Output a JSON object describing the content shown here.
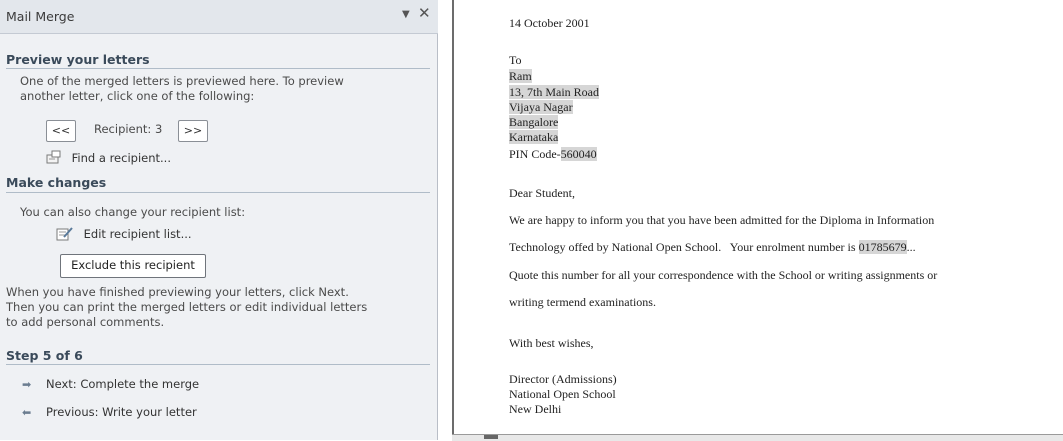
{
  "pane": {
    "title": "Mail Merge",
    "dropdown_glyph": "▼",
    "close_glyph": "✕",
    "preview": {
      "heading": "Preview your letters",
      "desc_line1": "One of the merged letters is previewed here. To preview",
      "desc_line2": "another letter, click one of the following:",
      "prev_label": "<<",
      "next_label": ">>",
      "recipient_label": "Recipient: 3",
      "find_label": "Find a recipient..."
    },
    "changes": {
      "heading": "Make changes",
      "desc": "You can also change your recipient list:",
      "edit_label": "Edit recipient list...",
      "exclude_label": "Exclude this recipient",
      "finish_line1": "When you have finished previewing your letters, click Next.",
      "finish_line2": "Then you can print the merged letters or edit individual letters",
      "finish_line3": "to add personal comments."
    },
    "step": {
      "heading": "Step 5 of 6",
      "next_label": "Next: Complete the merge",
      "prev_label": "Previous: Write your letter"
    }
  },
  "document": {
    "date": "14 October 2001",
    "to": "To",
    "name": "Ram",
    "address1": "13, 7th Main Road",
    "address2": "Vijaya Nagar",
    "city": "Bangalore",
    "state": "Karnataka",
    "pin_label": "PIN Code-",
    "pin_value": "560040",
    "salutation": "Dear Student,",
    "body_line1": "We are happy to inform you that you have been admitted for the Diploma in Information",
    "body_line2a": "Technology offed by National Open School.   Your enrolment number is ",
    "enrolment": "01785679",
    "body_line2b": "...",
    "body_line3": "Quote this number for all your correspondence with the School or writing assignments or",
    "body_line4": "writing termend examinations.",
    "closing": "With best wishes,",
    "sign1": "Director (Admissions)",
    "sign2": "National Open School",
    "sign3": "New Delhi"
  }
}
